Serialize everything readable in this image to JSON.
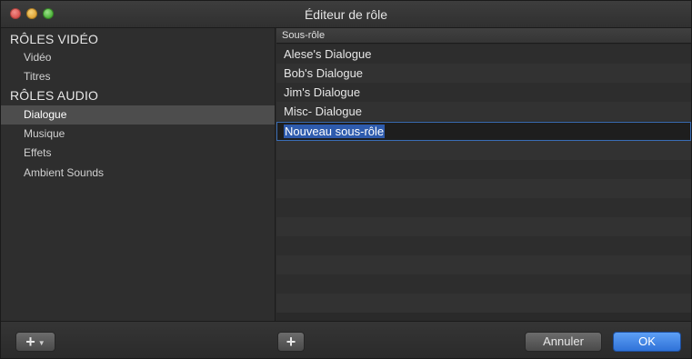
{
  "window": {
    "title": "Éditeur de rôle"
  },
  "sidebar": {
    "video_header": "RÔLES VIDÉO",
    "video_items": [
      {
        "label": "Vidéo"
      },
      {
        "label": "Titres"
      }
    ],
    "audio_header": "RÔLES AUDIO",
    "audio_items": [
      {
        "label": "Dialogue",
        "selected": true
      },
      {
        "label": "Musique"
      },
      {
        "label": "Effets"
      },
      {
        "label": "Ambient Sounds"
      }
    ]
  },
  "table": {
    "column_header": "Sous-rôle",
    "rows": [
      {
        "label": "Alese's Dialogue"
      },
      {
        "label": "Bob's Dialogue"
      },
      {
        "label": "Jim's Dialogue"
      },
      {
        "label": "Misc- Dialogue"
      }
    ],
    "editing_row_value": "Nouveau sous-rôle"
  },
  "footer": {
    "add_icon": "plus-icon",
    "dropdown_icon": "chevron-down-icon",
    "cancel_label": "Annuler",
    "ok_label": "OK"
  },
  "colors": {
    "accent": "#2f72d8",
    "selection": "#4d4d4d",
    "background": "#2b2b2b"
  }
}
